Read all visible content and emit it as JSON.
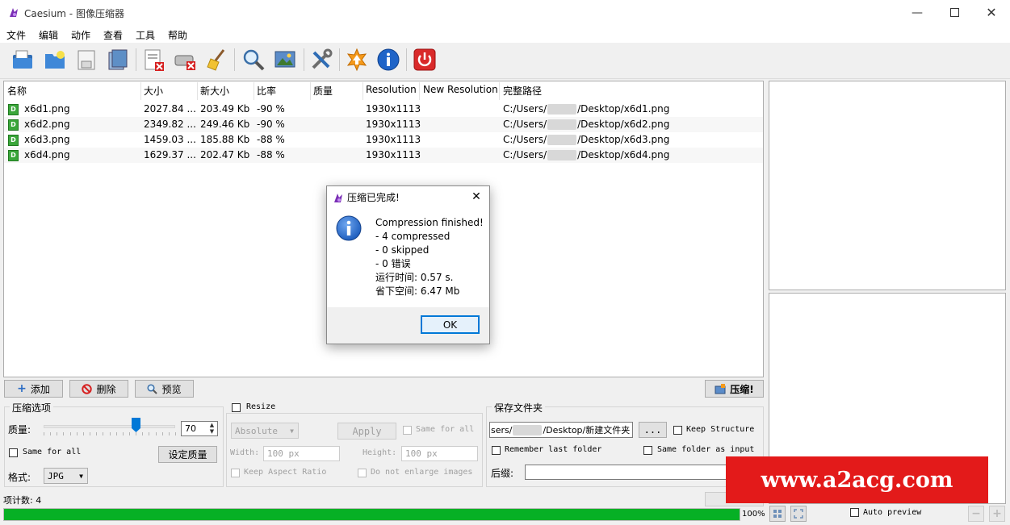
{
  "window": {
    "title": "Caesium - 图像压缩器"
  },
  "menu": [
    "文件",
    "编辑",
    "动作",
    "查看",
    "工具",
    "帮助"
  ],
  "table": {
    "columns": [
      "名称",
      "大小",
      "新大小",
      "比率",
      "质量",
      "Resolution",
      "New Resolution",
      "完整路径"
    ],
    "rows": [
      {
        "name": "x6d1.png",
        "size": "2027.84 ...",
        "new_size": "203.49 Kb",
        "ratio": "-90 %",
        "quality": "",
        "resolution": "1930x1113",
        "new_resolution": "",
        "path_prefix": "C:/Users/",
        "path_suffix": "/Desktop/x6d1.png"
      },
      {
        "name": "x6d2.png",
        "size": "2349.82 ...",
        "new_size": "249.46 Kb",
        "ratio": "-90 %",
        "quality": "",
        "resolution": "1930x1113",
        "new_resolution": "",
        "path_prefix": "C:/Users/",
        "path_suffix": "/Desktop/x6d2.png"
      },
      {
        "name": "x6d3.png",
        "size": "1459.03 ...",
        "new_size": "185.88 Kb",
        "ratio": "-88 %",
        "quality": "",
        "resolution": "1930x1113",
        "new_resolution": "",
        "path_prefix": "C:/Users/",
        "path_suffix": "/Desktop/x6d3.png"
      },
      {
        "name": "x6d4.png",
        "size": "1629.37 ...",
        "new_size": "202.47 Kb",
        "ratio": "-88 %",
        "quality": "",
        "resolution": "1930x1113",
        "new_resolution": "",
        "path_prefix": "C:/Users/",
        "path_suffix": "/Desktop/x6d4.png"
      }
    ]
  },
  "list_buttons": {
    "add": "添加",
    "remove": "删除",
    "preview": "预览",
    "compress": "压缩!"
  },
  "compression": {
    "group_title": "压缩选项",
    "quality_label": "质量:",
    "quality_value": "70",
    "quality_level_percent": 70,
    "same_for_all": "Same for all",
    "set_quality": "设定质量",
    "format_label": "格式:",
    "format_value": "JPG"
  },
  "resize": {
    "title": "Resize",
    "mode": "Absolute",
    "apply": "Apply",
    "same_for_all": "Same for all",
    "width_label": "Width:",
    "width_value": "100 px",
    "height_label": "Height:",
    "height_value": "100 px",
    "keep_aspect": "Keep Aspect Ratio",
    "no_enlarge": "Do not enlarge images"
  },
  "output": {
    "group_title": "保存文件夹",
    "folder_prefix": "sers/",
    "folder_suffix": "/Desktop/新建文件夹",
    "browse": "...",
    "keep_structure": "Keep Structure",
    "remember_last": "Remember last folder",
    "same_folder": "Same folder as input",
    "suffix_label": "后缀:"
  },
  "status": {
    "item_count": "项计数: 4",
    "progress_text": "100%",
    "progress_percent": 100,
    "auto_preview": "Auto preview"
  },
  "dialog": {
    "title": "压缩已完成!",
    "lines": [
      "Compression finished!",
      "- 4 compressed",
      "- 0 skipped",
      "- 0 错误",
      "运行时间: 0.57 s.",
      "省下空间: 6.47 Mb"
    ],
    "ok": "OK"
  },
  "watermark": "www.a2acg.com",
  "colors": {
    "progress": "#06b025",
    "watermark_bg": "#e31a1a",
    "dialog_icon": "#1f5fbf"
  },
  "icons": [
    "caesium-logo-icon",
    "open-files-icon",
    "open-folder-icon",
    "save-icon",
    "save-as-icon",
    "clear-list-icon",
    "remove-drive-icon",
    "broom-icon",
    "search-icon",
    "image-preview-icon",
    "tools-icon",
    "update-icon",
    "info-icon",
    "power-icon"
  ]
}
